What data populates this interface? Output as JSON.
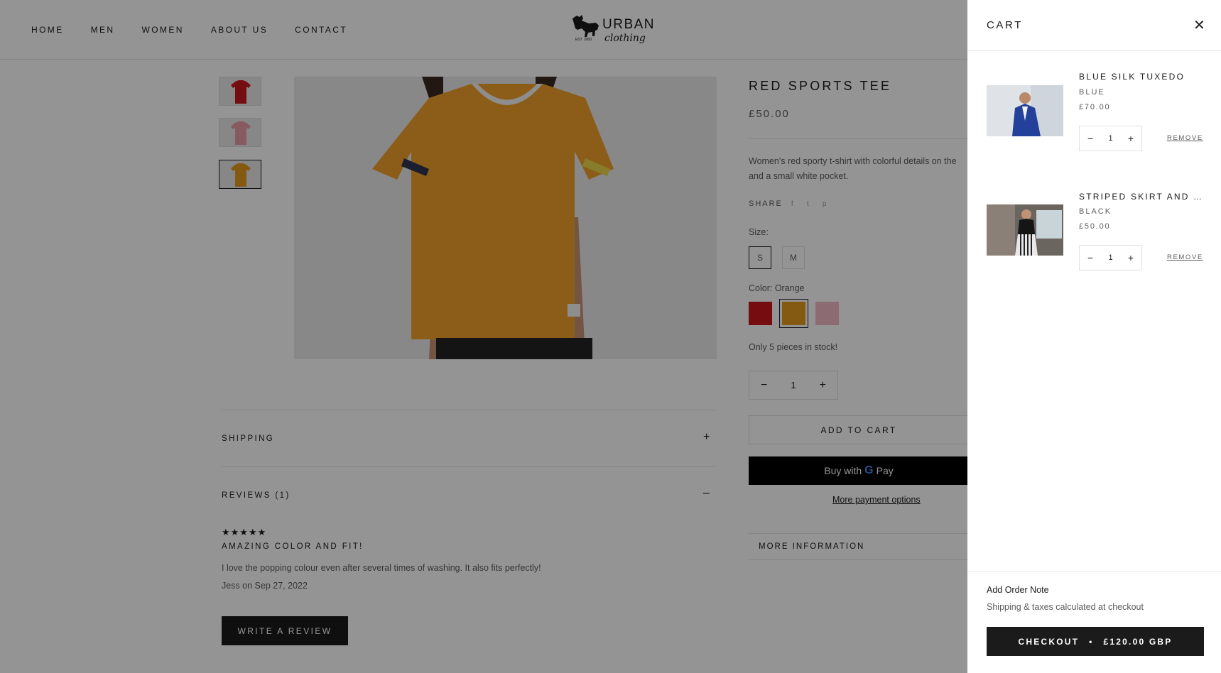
{
  "header": {
    "nav": [
      "HOME",
      "MEN",
      "WOMEN",
      "ABOUT US",
      "CONTACT"
    ],
    "logo_text": "URBAN",
    "logo_sub": "clothing",
    "logo_est": "EST. 2000"
  },
  "product": {
    "title": "RED SPORTS TEE",
    "price": "£50.00",
    "description": "Women's red sporty t-shirt with colorful details on the and a small white pocket.",
    "share_label": "SHARE",
    "size_label": "Size:",
    "sizes": [
      "S",
      "M"
    ],
    "selected_size": "S",
    "color_label": "Color: Orange",
    "colors": [
      "#c8161d",
      "#e39a1e",
      "#f3b8c4"
    ],
    "selected_color_index": 1,
    "stock_text": "Only 5 pieces in stock!",
    "quantity": "1",
    "add_to_cart": "ADD TO CART",
    "buy_with": "Buy with",
    "buy_g": "G",
    "buy_pay": "Pay",
    "more_payment": "More payment options",
    "more_info": "MORE INFORMATION"
  },
  "accordion": {
    "shipping": "SHIPPING",
    "shipping_sign": "+",
    "reviews": "REVIEWS (1)",
    "reviews_sign": "–"
  },
  "review": {
    "stars": "★★★★★",
    "rating": 5,
    "title": "AMAZING COLOR AND FIT!",
    "body": "I love the popping colour even after several times of washing. It also fits perfectly!",
    "meta": "Jess on Sep 27, 2022",
    "write_button": "WRITE A REVIEW"
  },
  "cart": {
    "title": "CART",
    "close": "✕",
    "items": [
      {
        "name": "BLUE SILK TUXEDO",
        "variant": "BLUE",
        "price": "£70.00",
        "qty": "1",
        "remove": "REMOVE"
      },
      {
        "name": "STRIPED SKIRT AND T…",
        "variant": "BLACK",
        "price": "£50.00",
        "qty": "1",
        "remove": "REMOVE"
      }
    ],
    "note": "Add Order Note",
    "shipping_note": "Shipping & taxes calculated at checkout",
    "checkout_label": "CHECKOUT",
    "checkout_dot": "•",
    "checkout_total": "£120.00 GBP"
  },
  "icons": {
    "minus": "−",
    "plus": "+",
    "facebook": "f",
    "twitter": "t",
    "pinterest": "p"
  }
}
